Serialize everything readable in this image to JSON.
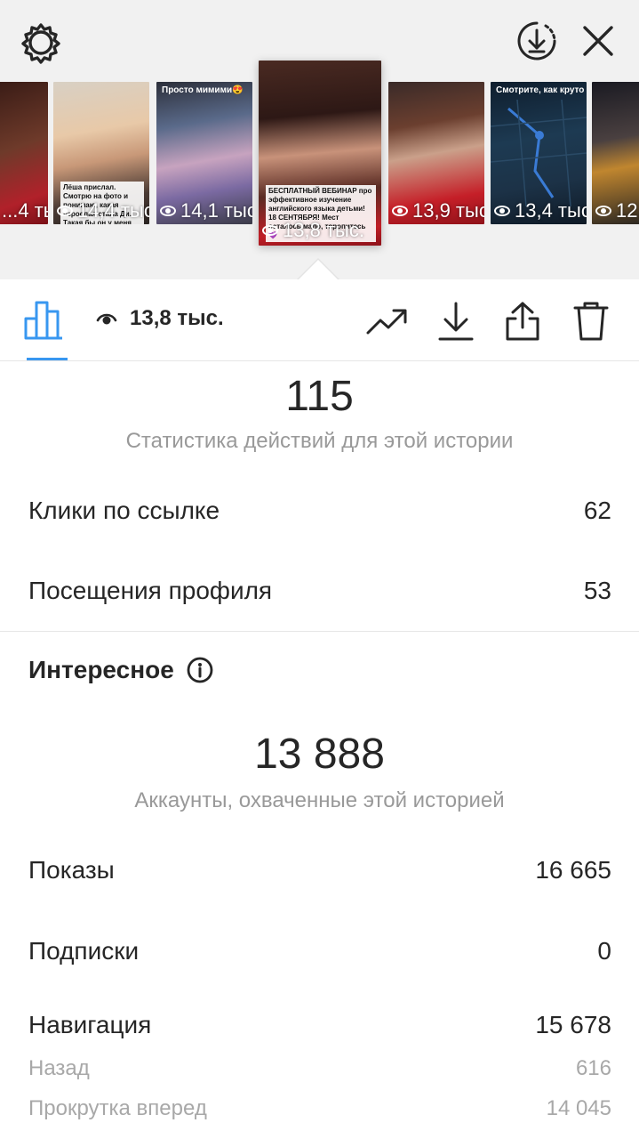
{
  "header": {
    "settings_icon": "gear-icon",
    "download_all_icon": "download-circle-icon",
    "close_icon": "close-icon"
  },
  "stories": [
    {
      "views": "...4 тыс.",
      "caption": "",
      "top_caption": ""
    },
    {
      "views": "14,4 тыс.",
      "caption": "Лёша прислал. Смотрю на фото и понимаю, какая взрослая стала Ди. Такая бы он у меня",
      "top_caption": ""
    },
    {
      "views": "14,1 тыс.",
      "caption": "",
      "top_caption": "Просто мимими😍"
    },
    {
      "views": "13,8 тыс.",
      "caption": "БЕСПЛАТНЫЙ ВЕБИНАР про эффективное изучение английского языка детьми! 18 СЕНТЯБРЯ! Мест осталось мало, торопитесь 💜",
      "top_caption": ""
    },
    {
      "views": "13,9 тыс.",
      "caption": "",
      "top_caption": ""
    },
    {
      "views": "13,4 тыс.",
      "caption": "",
      "top_caption": "Смотрите, как круто и просто"
    },
    {
      "views": "12...",
      "caption": "",
      "top_caption": ""
    }
  ],
  "toolbar": {
    "views_label": "13,8 тыс.",
    "icons": [
      "bar-chart-icon",
      "eye-icon",
      "trend-icon",
      "download-icon",
      "share-icon",
      "trash-icon"
    ]
  },
  "actions": {
    "total": "115",
    "caption": "Статистика действий для этой истории",
    "rows": [
      {
        "label": "Клики по ссылке",
        "value": "62"
      },
      {
        "label": "Посещения профиля",
        "value": "53"
      }
    ]
  },
  "discovery": {
    "title": "Интересное",
    "reach": "13 888",
    "reach_caption": "Аккаунты, охваченные этой историей",
    "rows": [
      {
        "label": "Показы",
        "value": "16 665"
      },
      {
        "label": "Подписки",
        "value": "0"
      },
      {
        "label": "Навигация",
        "value": "15 678"
      }
    ],
    "sub_rows": [
      {
        "label": "Назад",
        "value": "616"
      },
      {
        "label": "Прокрутка вперед",
        "value": "14 045"
      }
    ]
  },
  "colors": {
    "accent": "#3897f0",
    "text": "#262626",
    "muted": "#999999",
    "divider": "#e6e6e6"
  }
}
